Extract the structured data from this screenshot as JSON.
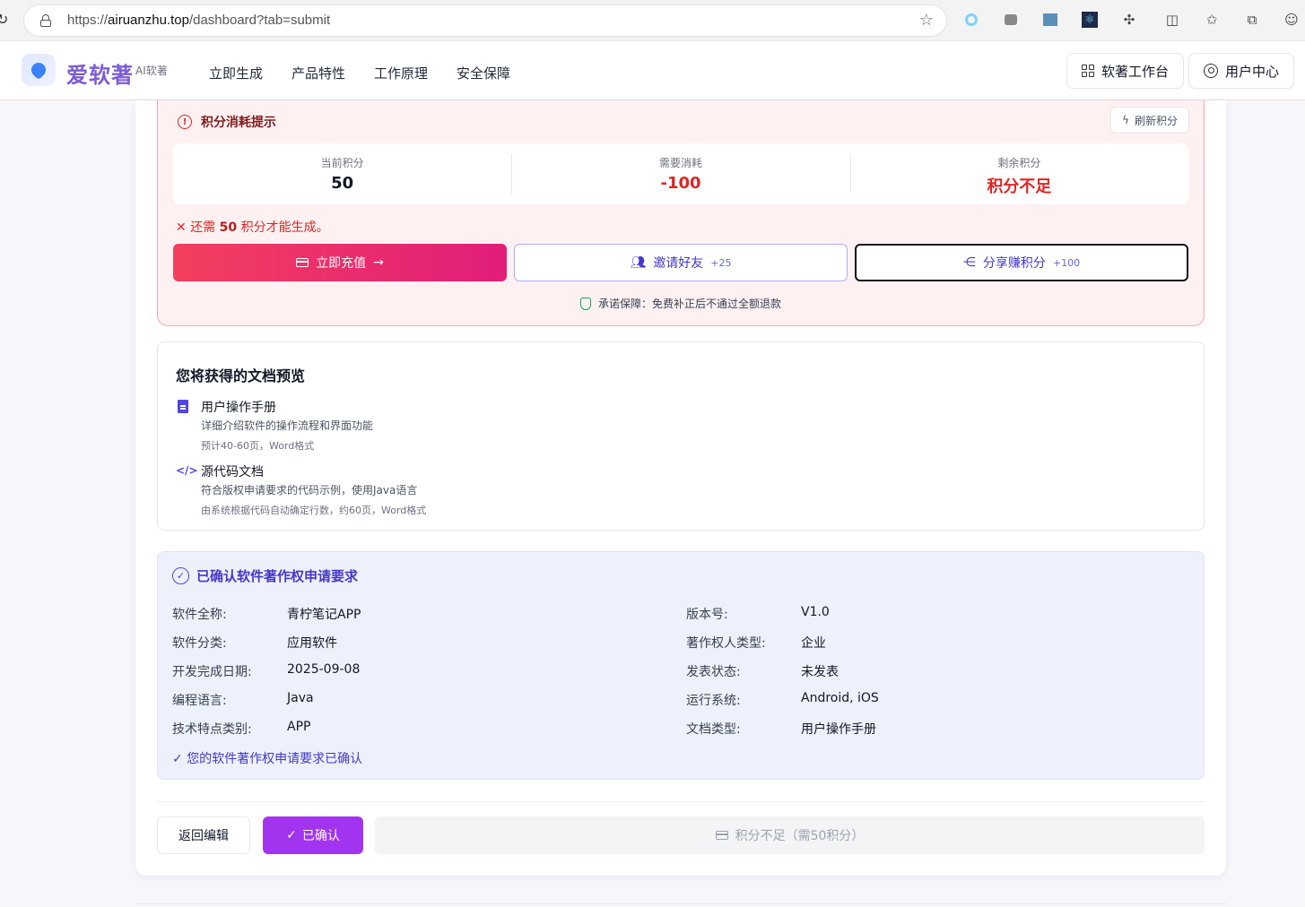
{
  "browser": {
    "url_scheme": "https://",
    "url_host": "airuanzhu.top",
    "url_path": "/dashboard?tab=submit"
  },
  "header": {
    "brand": "爱软著",
    "brand_sub": "AI软著",
    "nav": [
      "立即生成",
      "产品特性",
      "工作原理",
      "安全保障"
    ],
    "workbench_label": "软著工作台",
    "user_center_label": "用户中心"
  },
  "points": {
    "title": "积分消耗提示",
    "refresh_label": "刷新积分",
    "current_label": "当前积分",
    "current_value": "50",
    "cost_label": "需要消耗",
    "cost_value": "-100",
    "remaining_label": "剩余积分",
    "remaining_value": "积分不足",
    "need_prefix": "还需",
    "need_amount": "50",
    "need_suffix": "积分才能生成。",
    "recharge_label": "立即充值",
    "invite_label": "邀请好友",
    "invite_bonus": "+25",
    "share_label": "分享赚积分",
    "share_bonus": "+100",
    "guarantee": "承诺保障：免费补正后不通过全额退款"
  },
  "preview": {
    "title": "您将获得的文档预览",
    "docs": [
      {
        "name": "用户操作手册",
        "desc": "详细介绍软件的操作流程和界面功能",
        "meta": "预计40-60页，Word格式"
      },
      {
        "name": "源代码文档",
        "desc": "符合版权申请要求的代码示例，使用Java语言",
        "meta": "由系统根据代码自动确定行数，约60页，Word格式"
      }
    ]
  },
  "confirm": {
    "title": "已确认软件著作权申请要求",
    "fields_left": [
      {
        "label": "软件全称:",
        "value": "青柠笔记APP"
      },
      {
        "label": "软件分类:",
        "value": "应用软件"
      },
      {
        "label": "开发完成日期:",
        "value": "2025-09-08"
      },
      {
        "label": "编程语言:",
        "value": "Java"
      },
      {
        "label": "技术特点类别:",
        "value": "APP"
      }
    ],
    "fields_right": [
      {
        "label": "版本号:",
        "value": "V1.0"
      },
      {
        "label": "著作权人类型:",
        "value": "企业"
      },
      {
        "label": "发表状态:",
        "value": "未发表"
      },
      {
        "label": "运行系统:",
        "value": "Android, iOS"
      },
      {
        "label": "文档类型:",
        "value": "用户操作手册"
      }
    ],
    "ok_text": "您的软件著作权申请要求已确认"
  },
  "footer": {
    "back_label": "返回编辑",
    "confirmed_label": "已确认",
    "insufficient_label": "积分不足（需50积分）"
  },
  "colors": {
    "accent": "#a234f0",
    "danger": "#dc2626",
    "brand": "#7c5cd6",
    "indigo": "#4338ca"
  }
}
